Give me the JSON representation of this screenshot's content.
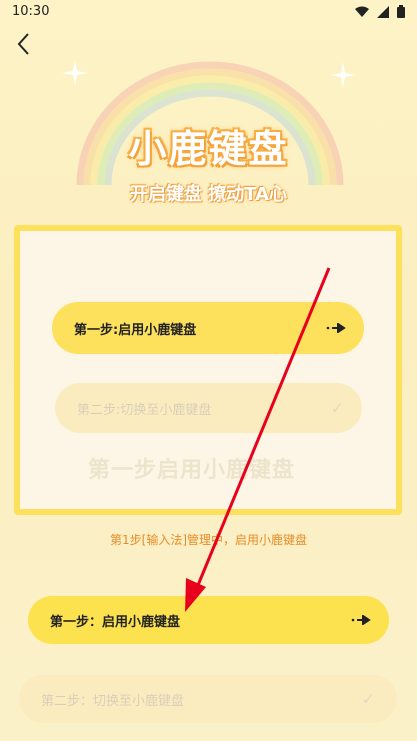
{
  "status": {
    "time": "10:30"
  },
  "header": {
    "title": "小鹿键盘",
    "subtitle": "开启键盘  撩动TA心"
  },
  "demo_card": {
    "step1": "第一步:启用小鹿键盘",
    "step2": "第二步:切换至小鹿键盘",
    "watermark": "第一步启用小鹿键盘"
  },
  "hint": "第1步[输入法]管理中，启用小鹿键盘",
  "buttons": {
    "step1": "第一步：启用小鹿键盘",
    "step2": "第二步：切换至小鹿键盘"
  },
  "colors": {
    "accent": "#fde15d",
    "hint": "#e98b27",
    "pointer": "#e8001c"
  }
}
